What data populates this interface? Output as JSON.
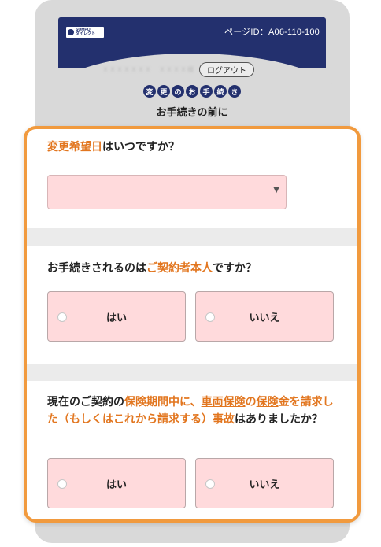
{
  "header": {
    "logo_text": "SOMPO\nダイレクト",
    "page_id": "ページID：A06-110-100",
    "user_name": "ＸＸＸＸＸＸＸ　ＸＸＸＸ様",
    "logout_label": "ログアウト",
    "procedure_tag": [
      "変",
      "更",
      "の",
      "お",
      "手",
      "続",
      "き"
    ],
    "procedure_title": "お手続きの前に"
  },
  "questions": {
    "q1": {
      "hl": "変更希望日",
      "rest": "はいつですか？"
    },
    "q2": {
      "pre": "お手続きされるのは",
      "hl": "ご契約者本人",
      "post": "ですか？"
    },
    "q3": {
      "pre": "現在のご契約の",
      "hl1": "保険期間中に、",
      "link1": "車両保険",
      "hl2": "の",
      "link2": "保険",
      "hl3": "金を請求した（もしくはこれから請求する）事故",
      "post": "はありましたか？"
    }
  },
  "select": {
    "value": "",
    "arrow": "▼"
  },
  "options": {
    "yes": "はい",
    "no": "いいえ"
  }
}
